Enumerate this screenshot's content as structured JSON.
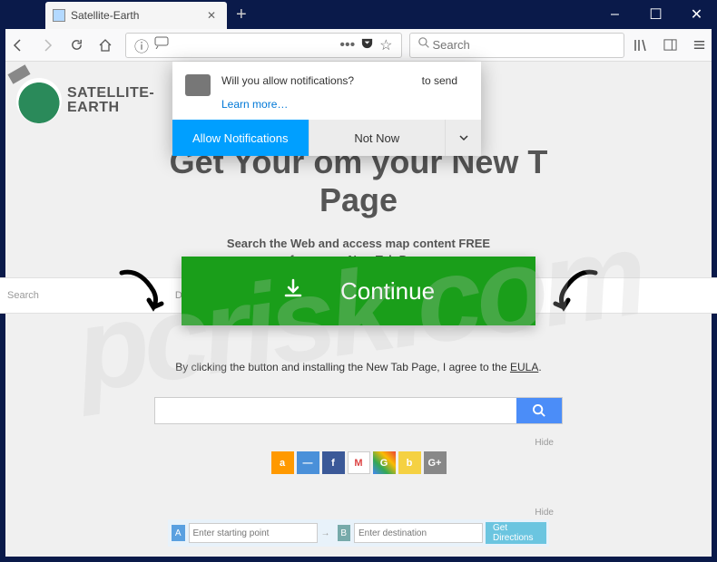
{
  "window": {
    "tab_title": "Satellite-Earth",
    "controls": {
      "min": "–",
      "max": "☐",
      "close": "✕"
    }
  },
  "toolbar": {
    "search_placeholder": "Search"
  },
  "logo": {
    "line1": "SATELLITE-",
    "line2": "EARTH"
  },
  "headline": {
    "line1": "Get Your                                                   om your New T",
    "line2": "Page"
  },
  "subhead": {
    "l1": "Search the Web and access map content FREE",
    "l2": "from your New Tab Page"
  },
  "direction_strip": {
    "search": "Search",
    "directions": "Directions"
  },
  "cta": {
    "label": "Continue"
  },
  "disclaimer": {
    "text": "By clicking the button and installing the New Tab Page, I agree to the ",
    "link": "EULA",
    "suffix": "."
  },
  "hide": "Hide",
  "dir": {
    "a": "A",
    "start": "Enter starting point",
    "b": "B",
    "dest": "Enter destination",
    "btn": "Get Directions"
  },
  "notif": {
    "sender": "to send",
    "question": "Will you allow notifications?",
    "learn": "Learn more…",
    "allow": "Allow Notifications",
    "notnow": "Not Now"
  },
  "watermark": "pcrisk.com",
  "quick": [
    "a",
    "—",
    "f",
    "M",
    "G",
    "b",
    "G+"
  ]
}
